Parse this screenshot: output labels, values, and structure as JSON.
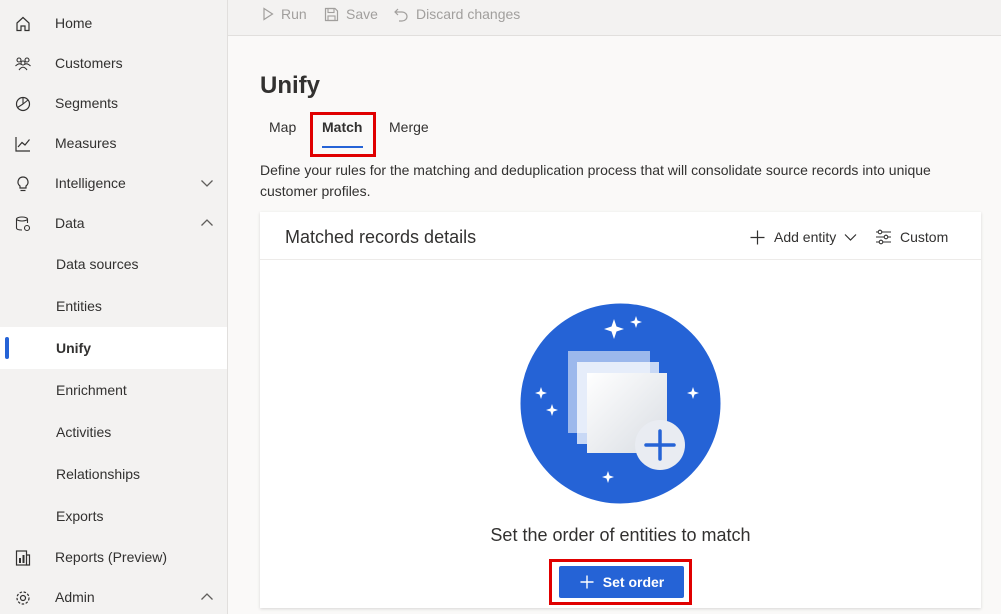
{
  "sidebar": {
    "items": [
      {
        "label": "Home",
        "icon": "home-icon"
      },
      {
        "label": "Customers",
        "icon": "customers-icon"
      },
      {
        "label": "Segments",
        "icon": "segments-icon"
      },
      {
        "label": "Measures",
        "icon": "measures-icon"
      },
      {
        "label": "Intelligence",
        "icon": "intelligence-icon"
      },
      {
        "label": "Data",
        "icon": "data-icon"
      }
    ],
    "data_subitems": [
      {
        "label": "Data sources"
      },
      {
        "label": "Entities"
      },
      {
        "label": "Unify"
      },
      {
        "label": "Enrichment"
      },
      {
        "label": "Activities"
      },
      {
        "label": "Relationships"
      },
      {
        "label": "Exports"
      }
    ],
    "bottom_items": [
      {
        "label": "Reports (Preview)",
        "icon": "reports-icon"
      },
      {
        "label": "Admin",
        "icon": "admin-icon"
      }
    ],
    "active_item": "Unify"
  },
  "command_bar": {
    "run_label": "Run",
    "save_label": "Save",
    "discard_label": "Discard changes"
  },
  "main": {
    "title": "Unify",
    "tabs": [
      {
        "label": "Map"
      },
      {
        "label": "Match"
      },
      {
        "label": "Merge"
      }
    ],
    "active_tab": "Match",
    "description": "Define your rules for the matching and deduplication process that will consolidate source records into unique customer profiles.",
    "card": {
      "title": "Matched records details",
      "add_entity_label": "Add entity",
      "custom_label": "Custom",
      "empty_state_title": "Set the order of entities to match",
      "set_order_label": "Set order"
    }
  },
  "colors": {
    "accent": "#2563d6",
    "highlight": "#e00000",
    "sidebar_bg": "#f3f2f1"
  }
}
